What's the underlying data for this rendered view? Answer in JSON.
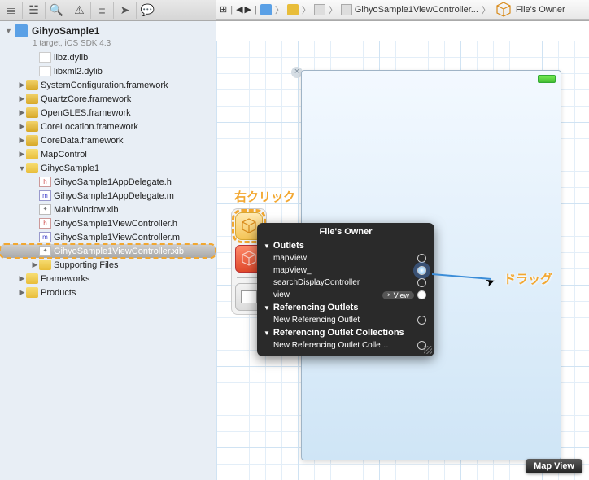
{
  "toolbar_icons": [
    "run",
    "stop",
    "breakpoint",
    "nav",
    "search",
    "issues",
    "debug",
    "log",
    "tag",
    "comment"
  ],
  "path": {
    "items": [
      "GihyoSample1ViewController...",
      "File's Owner"
    ],
    "nav_icons": [
      "grid",
      "back",
      "forward"
    ]
  },
  "project": {
    "name": "GihyoSample1",
    "subtitle": "1 target, iOS SDK 4.3"
  },
  "tree": [
    {
      "ind": 2,
      "icon": "lib",
      "label": "libz.dylib",
      "disc": "none"
    },
    {
      "ind": 2,
      "icon": "lib",
      "label": "libxml2.dylib",
      "disc": "none"
    },
    {
      "ind": 1,
      "icon": "fw",
      "label": "SystemConfiguration.framework",
      "disc": "▶"
    },
    {
      "ind": 1,
      "icon": "fw",
      "label": "QuartzCore.framework",
      "disc": "▶"
    },
    {
      "ind": 1,
      "icon": "fw",
      "label": "OpenGLES.framework",
      "disc": "▶"
    },
    {
      "ind": 1,
      "icon": "fw",
      "label": "CoreLocation.framework",
      "disc": "▶"
    },
    {
      "ind": 1,
      "icon": "fw",
      "label": "CoreData.framework",
      "disc": "▶"
    },
    {
      "ind": 1,
      "icon": "gf",
      "label": "MapControl",
      "disc": "▶"
    },
    {
      "ind": 1,
      "icon": "gf",
      "label": "GihyoSample1",
      "disc": "▼"
    },
    {
      "ind": 2,
      "icon": "h",
      "label": "GihyoSample1AppDelegate.h",
      "disc": "none"
    },
    {
      "ind": 2,
      "icon": "m",
      "label": "GihyoSample1AppDelegate.m",
      "disc": "none"
    },
    {
      "ind": 2,
      "icon": "xib",
      "label": "MainWindow.xib",
      "disc": "none"
    },
    {
      "ind": 2,
      "icon": "h",
      "label": "GihyoSample1ViewController.h",
      "disc": "none"
    },
    {
      "ind": 2,
      "icon": "m",
      "label": "GihyoSample1ViewController.m",
      "disc": "none"
    },
    {
      "ind": 2,
      "icon": "xib",
      "label": "GihyoSample1ViewController.xib",
      "disc": "none",
      "sel": true,
      "hl": true
    },
    {
      "ind": 2,
      "icon": "gf",
      "label": "Supporting Files",
      "disc": "▶"
    },
    {
      "ind": 1,
      "icon": "gf",
      "label": "Frameworks",
      "disc": "▶"
    },
    {
      "ind": 1,
      "icon": "gf",
      "label": "Products",
      "disc": "▶"
    }
  ],
  "annotations": {
    "right_click": "右クリック",
    "drag": "ドラッグ"
  },
  "popup": {
    "title": "File's Owner",
    "sections": [
      {
        "header": "Outlets",
        "items": [
          {
            "label": "mapView",
            "conn": "empty"
          },
          {
            "label": "mapView_",
            "conn": "glow"
          },
          {
            "label": "searchDisplayController",
            "conn": "empty"
          },
          {
            "label": "view",
            "pill": "View",
            "pill_x": "×",
            "conn": "fill"
          }
        ]
      },
      {
        "header": "Referencing Outlets",
        "items": [
          {
            "label": "New Referencing Outlet",
            "conn": "empty"
          }
        ]
      },
      {
        "header": "Referencing Outlet Collections",
        "items": [
          {
            "label": "New Referencing Outlet Colle…",
            "conn": "empty"
          }
        ]
      }
    ]
  },
  "badge": "Map View",
  "icon_glyphs": {
    "h": "h",
    "m": "m",
    "xib": "✦"
  }
}
